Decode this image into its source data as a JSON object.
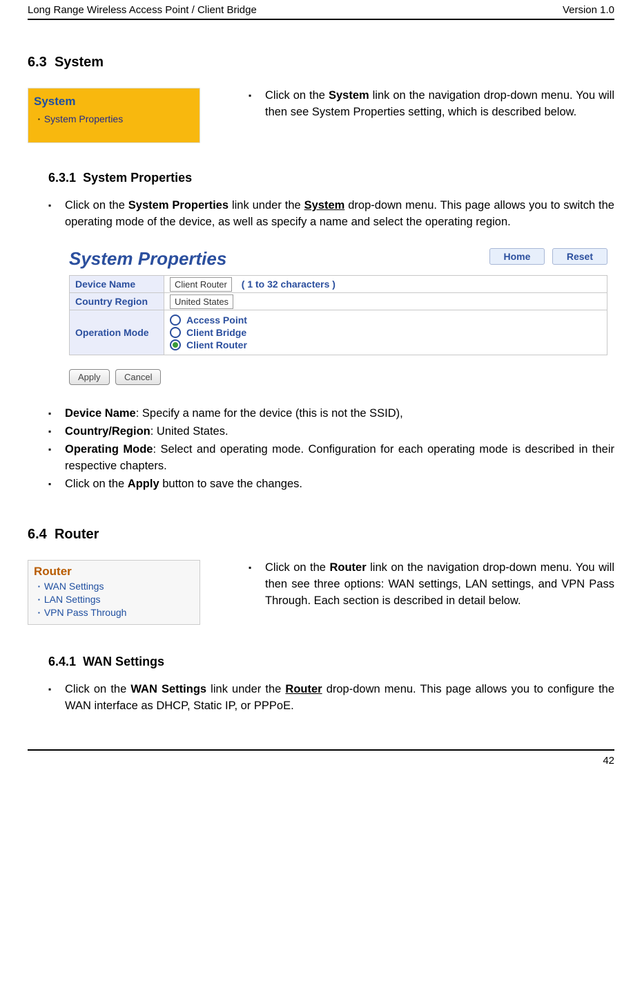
{
  "header": {
    "left": "Long Range Wireless Access Point / Client Bridge",
    "right": "Version 1.0"
  },
  "sections": {
    "s63_num": "6.3",
    "s63_title": "System",
    "s631_num": "6.3.1",
    "s631_title": "System Properties",
    "s64_num": "6.4",
    "s64_title": "Router",
    "s641_num": "6.4.1",
    "s641_title": "WAN Settings"
  },
  "menu_system": {
    "title": "System",
    "item1": "System Properties"
  },
  "menu_router": {
    "title": "Router",
    "item1": "WAN Settings",
    "item2": "LAN Settings",
    "item3": "VPN Pass Through"
  },
  "text": {
    "system_intro_pre": "Click on the ",
    "system_intro_bold": "System",
    "system_intro_post": " link on the navigation drop-down menu. You will then see System Properties setting, which is described below.",
    "sysprops_pre": "Click on the ",
    "sysprops_b1": "System Properties",
    "sysprops_mid": " link under the ",
    "sysprops_b2": "System",
    "sysprops_post": " drop-down menu. This page allows you to switch the operating mode of the device, as well as specify a name and select the operating region.",
    "dn_b": "Device Name",
    "dn_text": ": Specify a name for the device (this is not the SSID),",
    "cr_b": "Country/Region",
    "cr_text": ": United States.",
    "om_b": "Operating Mode",
    "om_text": ": Select and operating mode. Configuration for each operating mode is described in their respective chapters.",
    "apply_pre": "Click on the ",
    "apply_b": "Apply",
    "apply_post": " button to save the changes.",
    "router_intro_pre": "Click on the ",
    "router_intro_bold": "Router",
    "router_intro_post": " link on the navigation drop-down menu. You will then see three options: WAN settings, LAN settings, and VPN Pass Through. Each section is described in detail below.",
    "wan_pre": "Click on the ",
    "wan_b1": "WAN Settings",
    "wan_mid": " link under the ",
    "wan_b2": "Router",
    "wan_post": " drop-down menu. This page allows you to configure the WAN interface as DHCP, Static IP, or PPPoE."
  },
  "screenshot": {
    "title": "System Properties",
    "btn_home": "Home",
    "btn_reset": "Reset",
    "row1_label": "Device Name",
    "row1_value": "Client Router",
    "row1_note": "( 1 to 32 characters )",
    "row2_label": "Country Region",
    "row2_value": "United States",
    "row3_label": "Operation Mode",
    "opt1": "Access Point",
    "opt2": "Client Bridge",
    "opt3": "Client Router",
    "apply": "Apply",
    "cancel": "Cancel"
  },
  "footer": {
    "page": "42"
  }
}
